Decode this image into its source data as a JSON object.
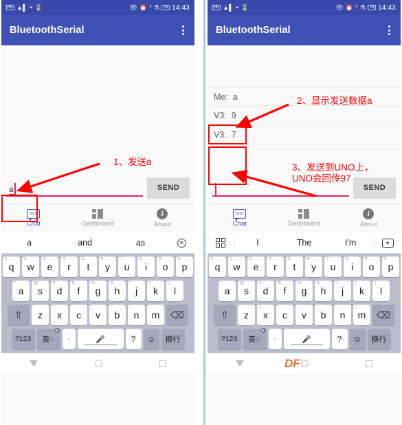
{
  "status_bar": {
    "icons_left": [
      "hd-icon",
      "signal-bars-icon",
      "wifi-icon",
      "hourglass-icon"
    ],
    "hd_label": "HD",
    "icons_right": [
      "eye-off-icon",
      "alarm-icon",
      "bluetooth-icon",
      "vibrate-off-icon"
    ],
    "battery_level": "76",
    "time": "14:43"
  },
  "app_bar": {
    "title": "BluetoothSerial",
    "overflow_menu": "more-options"
  },
  "left_panel": {
    "messages": [],
    "input": {
      "value": "a",
      "placeholder": ""
    },
    "send_label": "SEND",
    "suggestions": [
      "a",
      "and",
      "as"
    ],
    "suggestion_end_icon": "circle-x-icon"
  },
  "right_panel": {
    "messages": [
      {
        "sender": "Me:",
        "text": "a"
      },
      {
        "sender": "V3:",
        "text": "9"
      },
      {
        "sender": "V3:",
        "text": "7"
      }
    ],
    "input": {
      "value": "",
      "placeholder": ""
    },
    "send_label": "SEND",
    "suggestion_start_icon": "grid-four-icon",
    "suggestions": [
      "I",
      "The",
      "I'm"
    ],
    "suggestion_end_icon": "dropdown-box-icon"
  },
  "tabs": [
    {
      "label": "Chat",
      "icon": "chat-bubble-icon",
      "active": true
    },
    {
      "label": "Dashboard",
      "icon": "dashboard-grid-icon",
      "active": false
    },
    {
      "label": "About",
      "icon": "info-circle-icon",
      "active": false
    }
  ],
  "keyboard": {
    "row1": [
      {
        "key": "q",
        "hint": "1"
      },
      {
        "key": "w",
        "hint": "2"
      },
      {
        "key": "e",
        "hint": "3"
      },
      {
        "key": "r",
        "hint": "4"
      },
      {
        "key": "t",
        "hint": "5"
      },
      {
        "key": "y",
        "hint": "6"
      },
      {
        "key": "u",
        "hint": "7"
      },
      {
        "key": "i",
        "hint": "8"
      },
      {
        "key": "o",
        "hint": "9"
      },
      {
        "key": "p",
        "hint": "0"
      }
    ],
    "row2": [
      {
        "key": "a",
        "hint": "!"
      },
      {
        "key": "s",
        "hint": "@"
      },
      {
        "key": "d",
        "hint": "#"
      },
      {
        "key": "f",
        "hint": "$"
      },
      {
        "key": "g",
        "hint": "%"
      },
      {
        "key": "h",
        "hint": "&"
      },
      {
        "key": "j",
        "hint": "*"
      },
      {
        "key": "k",
        "hint": "("
      },
      {
        "key": "l",
        "hint": ")"
      }
    ],
    "row3": [
      {
        "key": "z",
        "hint": "'"
      },
      {
        "key": "x",
        "hint": "/"
      },
      {
        "key": "c",
        "hint": "-"
      },
      {
        "key": "v",
        "hint": "_"
      },
      {
        "key": "b",
        "hint": ":"
      },
      {
        "key": "n",
        "hint": ";"
      },
      {
        "key": "m",
        "hint": ","
      }
    ],
    "shift_icon": "shift-arrow-icon",
    "delete_icon": "backspace-icon",
    "numeric_label": "?123",
    "lang_label": "英",
    "lang_sub": "中",
    "lang_globe_icon": "globe-icon",
    "dot_label": "·",
    "space_icon": "microphone-icon",
    "question_label": "?",
    "emoji_icon": "smiley-icon",
    "enter_label": "换行"
  },
  "nav_bar": {
    "back_icon": "back-triangle-icon",
    "home_icon": "home-circle-icon",
    "recent_icon": "recent-square-icon",
    "watermark": "DF"
  },
  "annotations": [
    {
      "id": "a1",
      "text": "1、发送a"
    },
    {
      "id": "a2",
      "text": "2、显示发送数据a"
    },
    {
      "id": "a3",
      "text": "3、发送到UNO上，\nUNO会回传97"
    }
  ],
  "colors": {
    "app_bar": "#3f51b5",
    "status_bar": "#3949ab",
    "accent_pink": "#e91e63",
    "annotation_red": "#ff0000",
    "watermark_orange": "#e8702a",
    "active_tab": "#3f51b5"
  }
}
